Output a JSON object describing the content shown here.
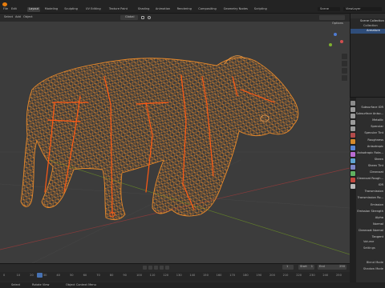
{
  "menu": {
    "app": "Blender",
    "items": [
      "File",
      "Edit",
      "Render",
      "Window",
      "Help"
    ]
  },
  "workspaces": [
    {
      "label": "Layout",
      "active": true
    },
    {
      "label": "Modeling",
      "active": false
    },
    {
      "label": "Sculpting",
      "active": false
    },
    {
      "label": "UV Editing",
      "active": false
    },
    {
      "label": "Texture Paint",
      "active": false
    },
    {
      "label": "Shading",
      "active": false
    },
    {
      "label": "Animation",
      "active": false
    },
    {
      "label": "Rendering",
      "active": false
    },
    {
      "label": "Compositing",
      "active": false
    },
    {
      "label": "Geometry Nodes",
      "active": false
    },
    {
      "label": "Scripting",
      "active": false
    }
  ],
  "scene": {
    "label": "Scene",
    "view_layer": "ViewLayer"
  },
  "viewport_header": {
    "mode_menu": [
      "Select",
      "Add",
      "Object"
    ],
    "transform": "Global",
    "options": "Options"
  },
  "outliner": {
    "title": "Scene Collection",
    "items": [
      "Collection",
      "Armature"
    ]
  },
  "properties": {
    "labels": [
      "Subsurface IOR",
      "Subsurface Aniso...",
      "Metallic",
      "Specular",
      "Specular Tint",
      "Roughness",
      "Anisotropic",
      "Anisotropic Rota...",
      "Sheen",
      "Sheen Tint",
      "Clearcoat",
      "Clearcoat Rough...",
      "IOR",
      "Transmission",
      "Transmission Ro...",
      "Emission",
      "Emission Strength",
      "Alpha",
      "Normal",
      "Clearcoat Normal",
      "Tangent"
    ],
    "sections": [
      "Volume",
      "Settings"
    ],
    "settings_rows": [
      "Blend Mode",
      "Shadow Mode"
    ]
  },
  "timeline": {
    "menu": [
      "Playback",
      "Keying",
      "View",
      "Marker"
    ],
    "current_frame": "1",
    "start": "1",
    "end": "250",
    "start_label": "Start",
    "end_label": "End",
    "ticks": [
      "0",
      "10",
      "20",
      "30",
      "40",
      "50",
      "60",
      "70",
      "80",
      "90",
      "100",
      "110",
      "120",
      "130",
      "140",
      "150",
      "160",
      "170",
      "180",
      "190",
      "200",
      "210",
      "220",
      "230",
      "240",
      "250"
    ]
  },
  "statusbar": {
    "left": "Select",
    "middle": "Rotate View",
    "right": "Object Context Menu"
  },
  "colors": {
    "wire": "#e8892a",
    "bone": "#ff5a14",
    "viewport_bg": "#3c3c3c",
    "accent": "#4772b3"
  }
}
